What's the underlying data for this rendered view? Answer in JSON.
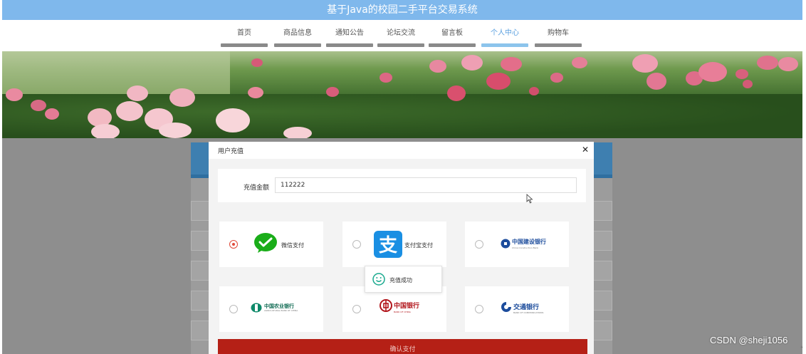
{
  "header": {
    "title": "基于Java的校园二手平台交易系统"
  },
  "nav": {
    "items": [
      {
        "label": "首页"
      },
      {
        "label": "商品信息"
      },
      {
        "label": "通知公告"
      },
      {
        "label": "论坛交流"
      },
      {
        "label": "留言板"
      },
      {
        "label": "个人中心",
        "active": true
      },
      {
        "label": "购物车"
      }
    ]
  },
  "modal": {
    "title": "用户充值",
    "close_icon": "close-icon",
    "amount_label": "充值金额",
    "amount_value": "112222",
    "payment_options": [
      {
        "label": "微信支付",
        "icon": "wechat-pay-icon",
        "selected": true
      },
      {
        "label": "支付宝支付",
        "icon": "alipay-icon",
        "selected": false
      },
      {
        "label": "中国建设银行",
        "sub": "China Construction Bank",
        "icon": "ccb-logo",
        "selected": false
      },
      {
        "label": "中国农业银行",
        "sub": "AGRICULTURAL BANK OF CHINA",
        "icon": "abc-logo",
        "selected": false
      },
      {
        "label": "中国银行",
        "sub": "BANK OF CHINA",
        "icon": "boc-logo",
        "selected": false
      },
      {
        "label": "交通银行",
        "sub": "BANK OF COMMUNICATIONS",
        "icon": "bocom-logo",
        "selected": false
      }
    ],
    "toast": {
      "text": "充值成功",
      "icon": "smile-icon"
    },
    "confirm_label": "确认支付"
  },
  "watermark": "CSDN @sheji1056",
  "colors": {
    "title_bar": "#7fb8ec",
    "nav_active": "#5aa0e0",
    "confirm": "#b52016",
    "radio_checked": "#e04a3a",
    "wechat": "#1aad19",
    "alipay": "#1a8fe3"
  }
}
